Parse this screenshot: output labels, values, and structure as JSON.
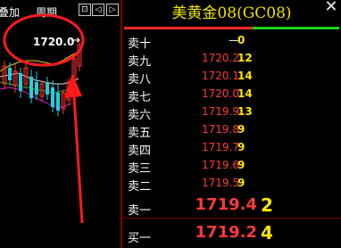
{
  "toolbar": {
    "overlay_label": "叠加",
    "period_label": "周期",
    "toggle_label": "⊡",
    "prev_label": "◁",
    "next_label": "▷"
  },
  "chart": {
    "price_flag": "1720.0",
    "price_flag_arrow": "→",
    "annotation_color": "#ff1a1a"
  },
  "quote": {
    "title": "美黄金08(GC08)",
    "asks": [
      {
        "label": "卖十",
        "price": "—",
        "volume": "0"
      },
      {
        "label": "卖九",
        "price": "1720.2",
        "volume": "12"
      },
      {
        "label": "卖八",
        "price": "1720.1",
        "volume": "14"
      },
      {
        "label": "卖七",
        "price": "1720.0",
        "volume": "14"
      },
      {
        "label": "卖六",
        "price": "1719.9",
        "volume": "13"
      },
      {
        "label": "卖五",
        "price": "1719.8",
        "volume": "9"
      },
      {
        "label": "卖四",
        "price": "1719.7",
        "volume": "9"
      },
      {
        "label": "卖三",
        "price": "1719.6",
        "volume": "9"
      },
      {
        "label": "卖二",
        "price": "1719.5",
        "volume": "9"
      },
      {
        "label": "卖一",
        "price": "1719.4",
        "volume": "2"
      }
    ],
    "bid": {
      "label": "买一",
      "price": "1719.2",
      "volume": "4"
    }
  },
  "colors": {
    "price_red": "#ff3b3b",
    "volume_yellow": "#ffe600",
    "title_yellow": "#f0e400",
    "up_green": "#1fd01f"
  }
}
